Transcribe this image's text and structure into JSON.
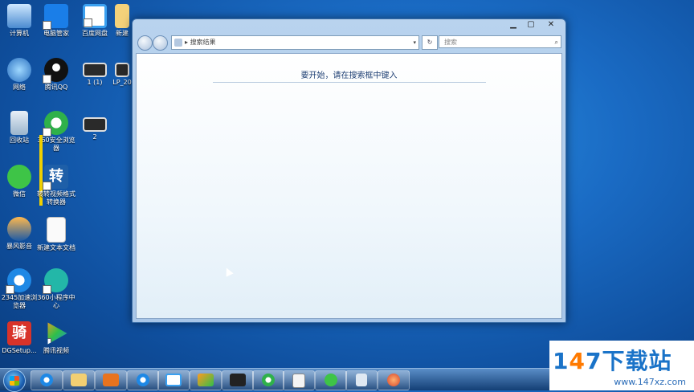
{
  "desktop": {
    "icons": [
      {
        "label": "计算机"
      },
      {
        "label": "电脑管家"
      },
      {
        "label": "百度网盘"
      },
      {
        "label": "新建"
      },
      {
        "label": "网络"
      },
      {
        "label": "腾讯QQ"
      },
      {
        "label": "1 (1)"
      },
      {
        "label": "LP_20"
      },
      {
        "label": "回收站"
      },
      {
        "label": "360安全浏览器"
      },
      {
        "label": "2"
      },
      {
        "label": "微信"
      },
      {
        "label": "转转视频格式转换器"
      },
      {
        "label": "暴风影音"
      },
      {
        "label": "新建文本文档"
      },
      {
        "label": "2345加速浏览器"
      },
      {
        "label": "360小程序中心"
      },
      {
        "label": "DGSetup..."
      },
      {
        "label": "腾讯视频"
      }
    ],
    "zhuan_glyph": "转",
    "yin_glyph": "骑"
  },
  "window": {
    "min_glyph": "▁",
    "max_glyph": "▢",
    "close_glyph": "✕",
    "address_text": "搜索结果",
    "address_arrow": "▸",
    "dropdown_glyph": "▾",
    "refresh_glyph": "↻",
    "search_placeholder": "搜索",
    "search_glyph": "⌕",
    "hint": "要开始，请在搜索框中键入"
  },
  "watermark": {
    "digits_a": "1",
    "digits_o": "4",
    "digits_b": "7下载站",
    "url": "www.147xz.com"
  },
  "colors": {
    "accent": "#1a73c8",
    "orange": "#ff7a00"
  }
}
